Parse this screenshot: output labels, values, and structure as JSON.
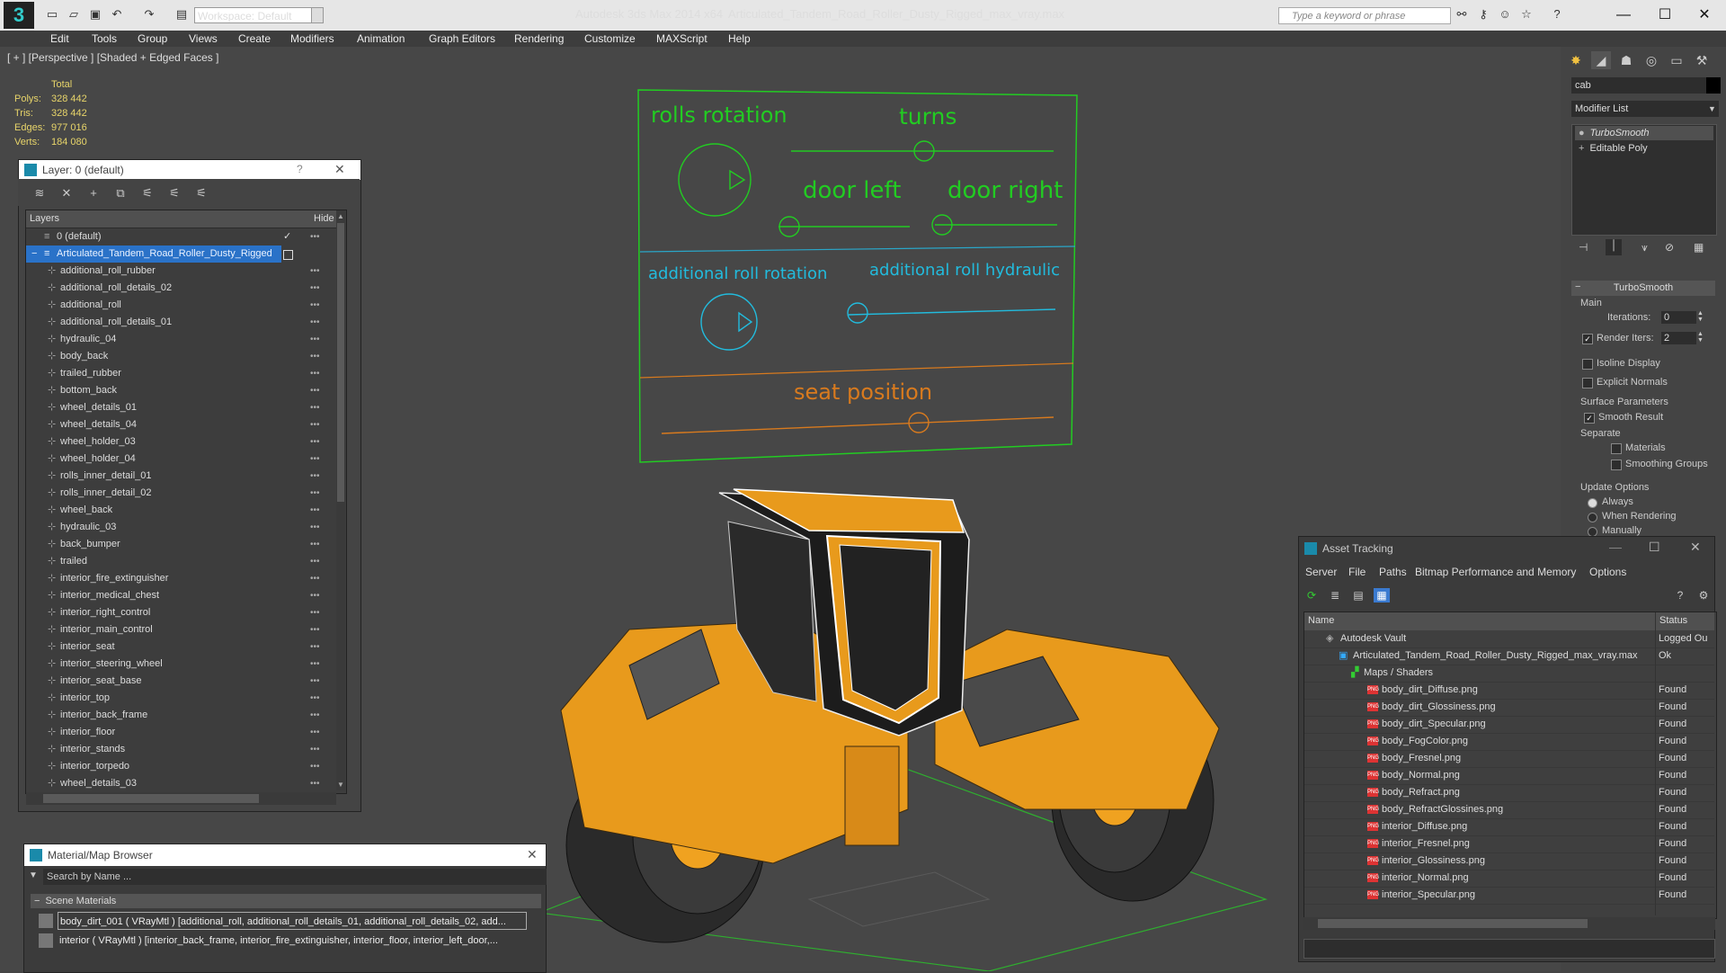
{
  "titlebar": {
    "workspace": "Workspace: Default",
    "app_title": "Autodesk 3ds Max  2014 x64",
    "file_title": "Articulated_Tandem_Road_Roller_Dusty_Rigged_max_vray.max",
    "search_placeholder": "Type a keyword or phrase",
    "icons": [
      "new-icon",
      "open-icon",
      "save-icon",
      "undo-icon",
      "redo-icon",
      "binoculars-icon",
      "star-icon",
      "help-icon",
      "minimize-icon",
      "maximize-icon",
      "close-icon"
    ]
  },
  "menu": [
    "Edit",
    "Tools",
    "Group",
    "Views",
    "Create",
    "Modifiers",
    "Animation",
    "Graph Editors",
    "Rendering",
    "Customize",
    "MAXScript",
    "Help"
  ],
  "viewport": {
    "label": "[ + ] [Perspective ] [Shaded + Edged Faces ]",
    "stats": {
      "header": "Total",
      "rows": [
        {
          "label": "Polys:",
          "value": "328 442"
        },
        {
          "label": "Tris:",
          "value": "328 442"
        },
        {
          "label": "Edges:",
          "value": "977 016"
        },
        {
          "label": "Verts:",
          "value": "184 080"
        }
      ]
    },
    "rig": {
      "rolls_rotation": "rolls rotation",
      "turns": "turns",
      "door_left": "door left",
      "door_right": "door right",
      "additional_roll_rotation": "additional roll rotation",
      "additional_roll_hydraulic": "additional roll hydraulic",
      "seat_position": "seat position",
      "colors": {
        "green": "#22cc22",
        "cyan": "#22bbdd",
        "orange": "#d87a1e"
      }
    }
  },
  "layer_panel": {
    "title": "Layer: 0 (default)",
    "help": "?",
    "col_layers": "Layers",
    "col_hide": "Hide",
    "default_layer": "0 (default)",
    "selected_layer": "Articulated_Tandem_Road_Roller_Dusty_Rigged",
    "items": [
      "additional_roll_rubber",
      "additional_roll_details_02",
      "additional_roll",
      "additional_roll_details_01",
      "hydraulic_04",
      "body_back",
      "trailed_rubber",
      "bottom_back",
      "wheel_details_01",
      "wheel_details_04",
      "wheel_holder_03",
      "wheel_holder_04",
      "rolls_inner_detail_01",
      "rolls_inner_detail_02",
      "wheel_back",
      "hydraulic_03",
      "back_bumper",
      "trailed",
      "interior_fire_extinguisher",
      "interior_medical_chest",
      "interior_right_control",
      "interior_main_control",
      "interior_seat",
      "interior_steering_wheel",
      "interior_seat_base",
      "interior_top",
      "interior_back_frame",
      "interior_floor",
      "interior_stands",
      "interior_torpedo",
      "wheel_details_03"
    ]
  },
  "material_browser": {
    "title": "Material/Map Browser",
    "search_placeholder": "Search by Name ...",
    "section": "Scene Materials",
    "rows": [
      "body_dirt_001 ( VRayMtl ) [additional_roll, additional_roll_details_01, additional_roll_details_02, add...",
      "interior ( VRayMtl ) [interior_back_frame, interior_fire_extinguisher, interior_floor, interior_left_door,..."
    ]
  },
  "command_panel": {
    "name_field": "cab",
    "modifier_list": "Modifier List",
    "stack": [
      "TurboSmooth",
      "Editable Poly"
    ],
    "turbosmooth": {
      "title": "TurboSmooth",
      "main": "Main",
      "iterations_label": "Iterations:",
      "iterations": "0",
      "render_iters_label": "Render Iters:",
      "render_iters": "2",
      "isoline": "Isoline Display",
      "explicit": "Explicit Normals",
      "surface": "Surface Parameters",
      "smooth_result": "Smooth Result",
      "separate": "Separate",
      "materials": "Materials",
      "smoothing_groups": "Smoothing Groups",
      "update": "Update Options",
      "always": "Always",
      "when_rendering": "When Rendering",
      "manually": "Manually"
    }
  },
  "asset_tracking": {
    "title": "Asset Tracking",
    "menu": [
      "Server",
      "File",
      "Paths",
      "Bitmap Performance and Memory",
      "Options"
    ],
    "col_name": "Name",
    "col_status": "Status",
    "vault": {
      "name": "Autodesk Vault",
      "status": "Logged Ou"
    },
    "file": {
      "name": "Articulated_Tandem_Road_Roller_Dusty_Rigged_max_vray.max",
      "status": "Ok"
    },
    "maps": "Maps / Shaders",
    "files": [
      {
        "name": "body_dirt_Diffuse.png",
        "status": "Found"
      },
      {
        "name": "body_dirt_Glossiness.png",
        "status": "Found"
      },
      {
        "name": "body_dirt_Specular.png",
        "status": "Found"
      },
      {
        "name": "body_FogColor.png",
        "status": "Found"
      },
      {
        "name": "body_Fresnel.png",
        "status": "Found"
      },
      {
        "name": "body_Normal.png",
        "status": "Found"
      },
      {
        "name": "body_Refract.png",
        "status": "Found"
      },
      {
        "name": "body_RefractGlossines.png",
        "status": "Found"
      },
      {
        "name": "interior_Diffuse.png",
        "status": "Found"
      },
      {
        "name": "interior_Fresnel.png",
        "status": "Found"
      },
      {
        "name": "interior_Glossiness.png",
        "status": "Found"
      },
      {
        "name": "interior_Normal.png",
        "status": "Found"
      },
      {
        "name": "interior_Specular.png",
        "status": "Found"
      }
    ]
  }
}
